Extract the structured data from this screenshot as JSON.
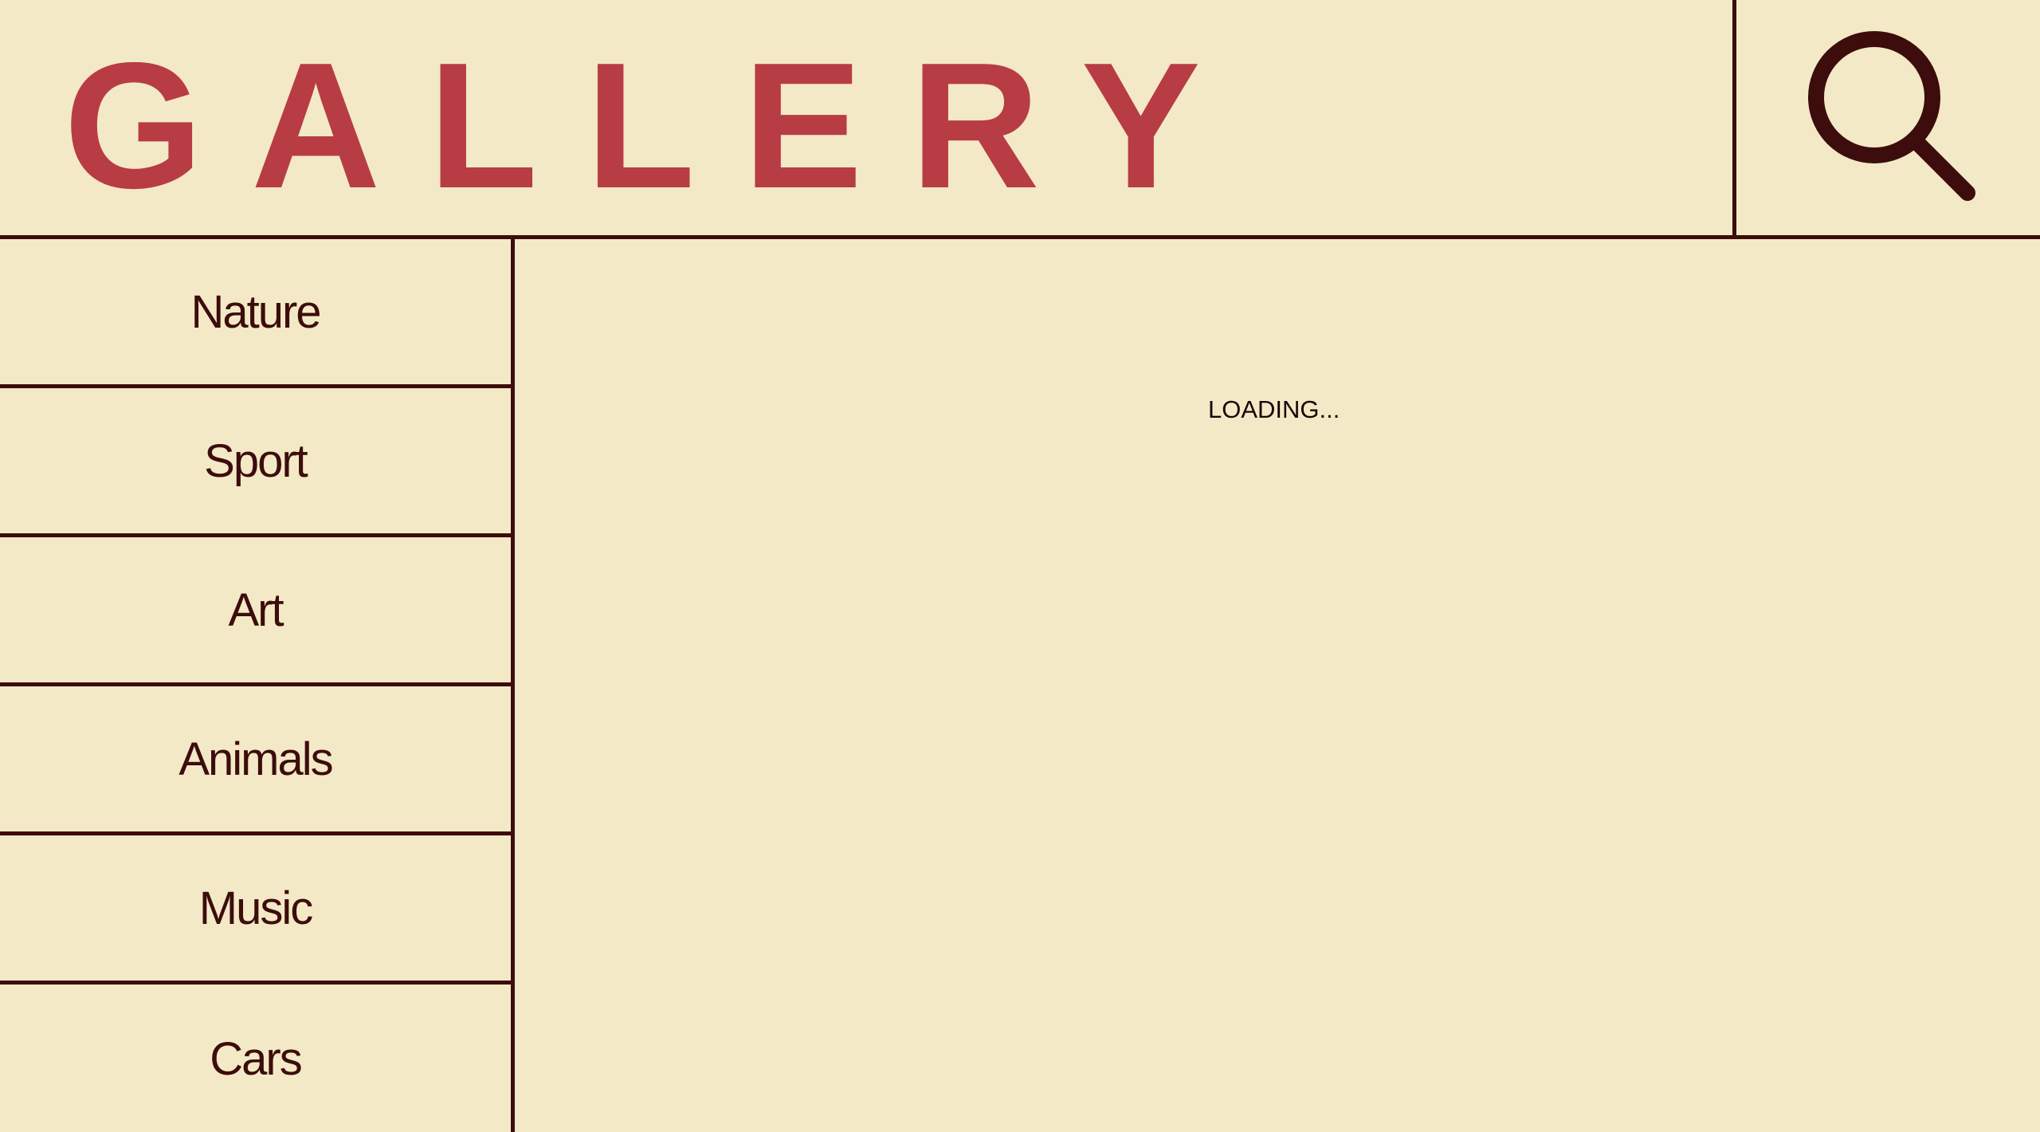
{
  "header": {
    "logo_text": "GALLERY",
    "search_icon": "search-icon"
  },
  "sidebar": {
    "items": [
      {
        "label": "Nature"
      },
      {
        "label": "Sport"
      },
      {
        "label": "Art"
      },
      {
        "label": "Animals"
      },
      {
        "label": "Music"
      },
      {
        "label": "Cars"
      }
    ]
  },
  "main": {
    "status_text": "LOADING..."
  },
  "colors": {
    "background": "#f3e9c6",
    "brand": "#b83c44",
    "border": "#3d0c0c",
    "text": "#3d0c0c"
  }
}
